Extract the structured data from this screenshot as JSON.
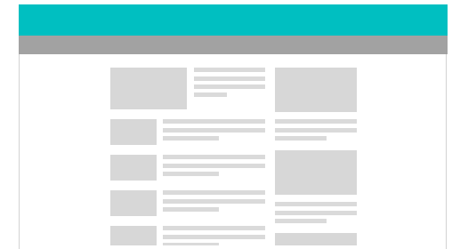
{
  "page": {
    "background": "#ffffff",
    "header_color": "#00bfc1",
    "nav_color": "#a2a2a2",
    "placeholder_color": "#d7d7d7"
  },
  "content": {
    "text": "",
    "note": ""
  }
}
